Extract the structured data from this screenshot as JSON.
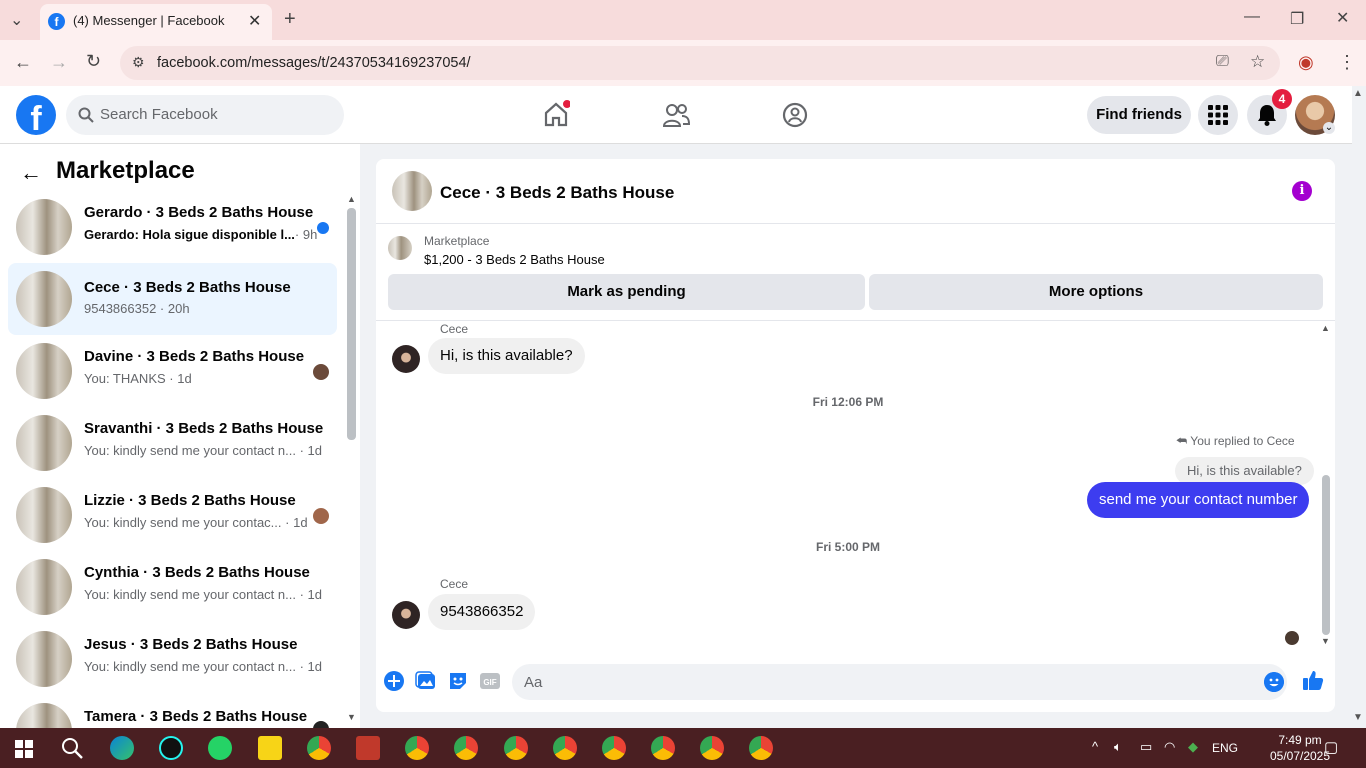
{
  "browser": {
    "tab_title": "(4) Messenger | Facebook",
    "url": "facebook.com/messages/t/24370534169237054/"
  },
  "header": {
    "search_placeholder": "Search Facebook",
    "find_friends_label": "Find friends",
    "notification_count": "4"
  },
  "sidebar": {
    "heading": "Marketplace",
    "conversations": [
      {
        "name": "Gerardo · 3 Beds 2 Baths House",
        "preview": "Gerardo: Hola sigue disponible l...",
        "time": "· 9h",
        "unread": true
      },
      {
        "name": "Cece · 3 Beds 2 Baths House",
        "preview": "9543866352 · 20h",
        "time": "",
        "active": true
      },
      {
        "name": "Davine · 3 Beds 2 Baths House",
        "preview": "You: THANKS · 1d",
        "time": ""
      },
      {
        "name": "Sravanthi · 3 Beds 2 Baths House",
        "preview": "You: kindly send me your contact n...",
        "time": "· 1d"
      },
      {
        "name": "Lizzie · 3 Beds 2 Baths House",
        "preview": "You: kindly send me your contac...",
        "time": "· 1d"
      },
      {
        "name": "Cynthia · 3 Beds 2 Baths House",
        "preview": "You: kindly send me your contact n...",
        "time": "· 1d"
      },
      {
        "name": "Jesus · 3 Beds 2 Baths House",
        "preview": "You: kindly send me your contact n...",
        "time": "· 1d"
      },
      {
        "name": "Tamera · 3 Beds 2 Baths House",
        "preview": "",
        "time": ""
      }
    ]
  },
  "chat": {
    "title": "Cece · 3 Beds 2 Baths House",
    "listing_category": "Marketplace",
    "listing_price": "$1,200 - 3 Beds 2 Baths House",
    "mark_pending_label": "Mark as pending",
    "more_options_label": "More options",
    "sender_1": "Cece",
    "msg_1": "Hi, is this available?",
    "stamp_1": "Fri 12:06 PM",
    "replied_label": "You replied to Cece",
    "quoted": "Hi, is this available?",
    "outgoing": "send me your contact number",
    "stamp_2": "Fri 5:00 PM",
    "sender_2": "Cece",
    "msg_2": "9543866352",
    "composer_placeholder": "Aa"
  },
  "taskbar": {
    "language": "ENG",
    "time": "7:49 pm",
    "date": "05/07/2025"
  }
}
